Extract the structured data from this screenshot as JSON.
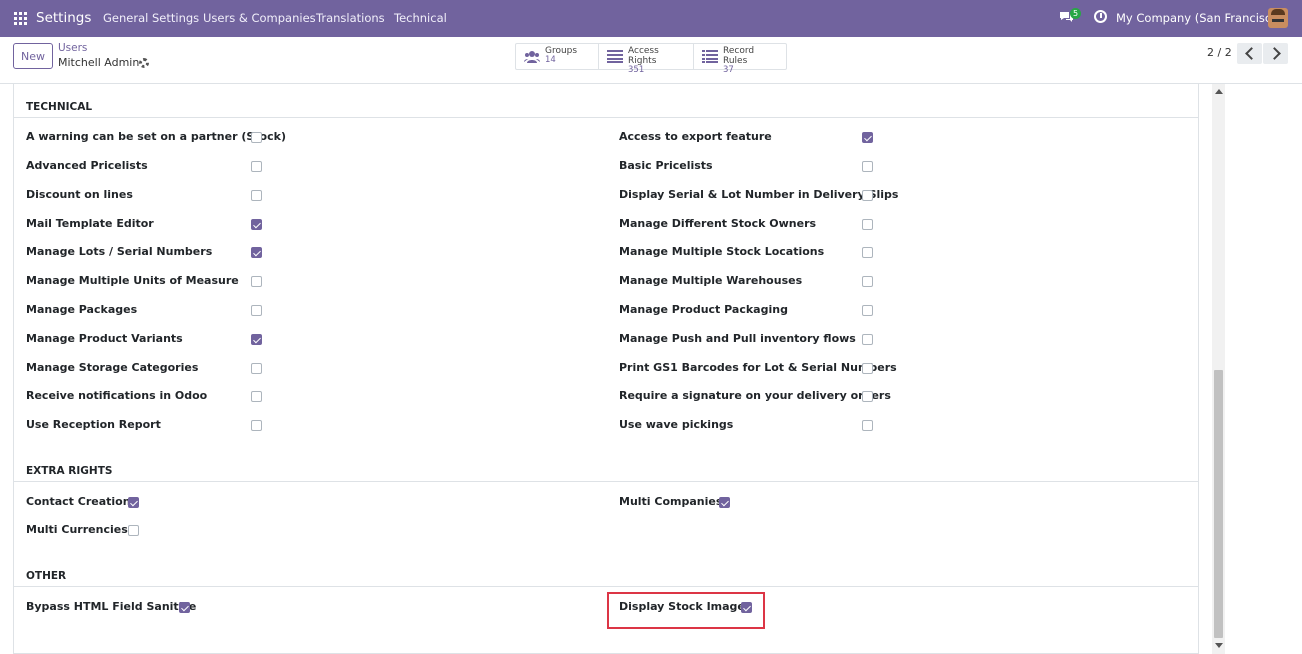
{
  "navbar": {
    "app_name": "Settings",
    "menu": [
      "General Settings",
      "Users & Companies",
      "Translations",
      "Technical"
    ],
    "chat_count": "5",
    "company": "My Company (San Francisco)"
  },
  "control_panel": {
    "new_label": "New",
    "breadcrumb_parent": "Users",
    "breadcrumb_current": "Mitchell Admin",
    "stats": [
      {
        "label": "Groups",
        "value": "14",
        "icon": "users-icon"
      },
      {
        "label": "Access Rights",
        "value": "351",
        "icon": "list-icon"
      },
      {
        "label": "Record Rules",
        "value": "37",
        "icon": "list-icon"
      }
    ],
    "pager": "2 / 2"
  },
  "sections": {
    "technical": {
      "title": "TECHNICAL",
      "left": [
        {
          "label": "A warning can be set on a partner (Stock)",
          "checked": false
        },
        {
          "label": "Advanced Pricelists",
          "checked": false
        },
        {
          "label": "Discount on lines",
          "checked": false
        },
        {
          "label": "Mail Template Editor",
          "checked": true
        },
        {
          "label": "Manage Lots / Serial Numbers",
          "checked": true
        },
        {
          "label": "Manage Multiple Units of Measure",
          "checked": false
        },
        {
          "label": "Manage Packages",
          "checked": false
        },
        {
          "label": "Manage Product Variants",
          "checked": true
        },
        {
          "label": "Manage Storage Categories",
          "checked": false
        },
        {
          "label": "Receive notifications in Odoo",
          "checked": false
        },
        {
          "label": "Use Reception Report",
          "checked": false
        }
      ],
      "right": [
        {
          "label": "Access to export feature",
          "checked": true
        },
        {
          "label": "Basic Pricelists",
          "checked": false
        },
        {
          "label": "Display Serial & Lot Number in Delivery Slips",
          "checked": false
        },
        {
          "label": "Manage Different Stock Owners",
          "checked": false
        },
        {
          "label": "Manage Multiple Stock Locations",
          "checked": false
        },
        {
          "label": "Manage Multiple Warehouses",
          "checked": false
        },
        {
          "label": "Manage Product Packaging",
          "checked": false
        },
        {
          "label": "Manage Push and Pull inventory flows",
          "checked": false
        },
        {
          "label": "Print GS1 Barcodes for Lot & Serial Numbers",
          "checked": false
        },
        {
          "label": "Require a signature on your delivery orders",
          "checked": false
        },
        {
          "label": "Use wave pickings",
          "checked": false
        }
      ]
    },
    "extra_rights": {
      "title": "EXTRA RIGHTS",
      "left": [
        {
          "label": "Contact Creation",
          "checked": true
        },
        {
          "label": "Multi Currencies",
          "checked": false
        }
      ],
      "right": [
        {
          "label": "Multi Companies",
          "checked": true
        }
      ]
    },
    "other": {
      "title": "OTHER",
      "left": [
        {
          "label": "Bypass HTML Field Sanitize",
          "checked": true
        }
      ],
      "right": [
        {
          "label": "Display Stock Images",
          "checked": true
        }
      ]
    }
  },
  "colors": {
    "primary": "#71639e",
    "highlight": "#dc3545",
    "badge": "#28a745"
  }
}
